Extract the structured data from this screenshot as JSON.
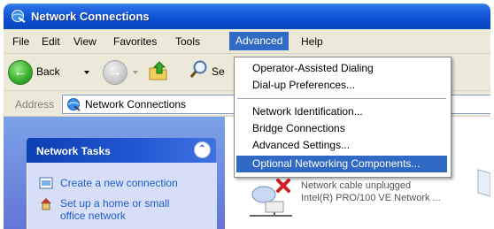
{
  "window": {
    "title": "Network Connections"
  },
  "menubar": {
    "items": [
      {
        "label": "File"
      },
      {
        "label": "Edit"
      },
      {
        "label": "View"
      },
      {
        "label": "Favorites"
      },
      {
        "label": "Tools"
      },
      {
        "label": "Advanced",
        "active": true
      },
      {
        "label": "Help"
      }
    ]
  },
  "toolbar": {
    "back_label": "Back",
    "search_label": "Se"
  },
  "address": {
    "label": "Address",
    "value": "Network Connections"
  },
  "advanced_menu": {
    "items": [
      {
        "label": "Operator-Assisted Dialing"
      },
      {
        "label": "Dial-up Preferences..."
      },
      {
        "label": "Network Identification..."
      },
      {
        "label": "Bridge Connections"
      },
      {
        "label": "Advanced Settings..."
      },
      {
        "label": "Optional Networking Components...",
        "highlighted": true
      }
    ]
  },
  "taskpane": {
    "title": "Network Tasks",
    "tasks": [
      {
        "label": "Create a new connection"
      },
      {
        "label": "Set up a home or small",
        "label_line2": "office network"
      }
    ]
  },
  "connection": {
    "status": "Network cable unplugged",
    "device": "Intel(R) PRO/100 VE Network ..."
  },
  "colors": {
    "highlight": "#316ac5",
    "titlebar": "#0a49c9",
    "task_link": "#215dc6",
    "taskpane_bg": "#7ba2e7"
  }
}
